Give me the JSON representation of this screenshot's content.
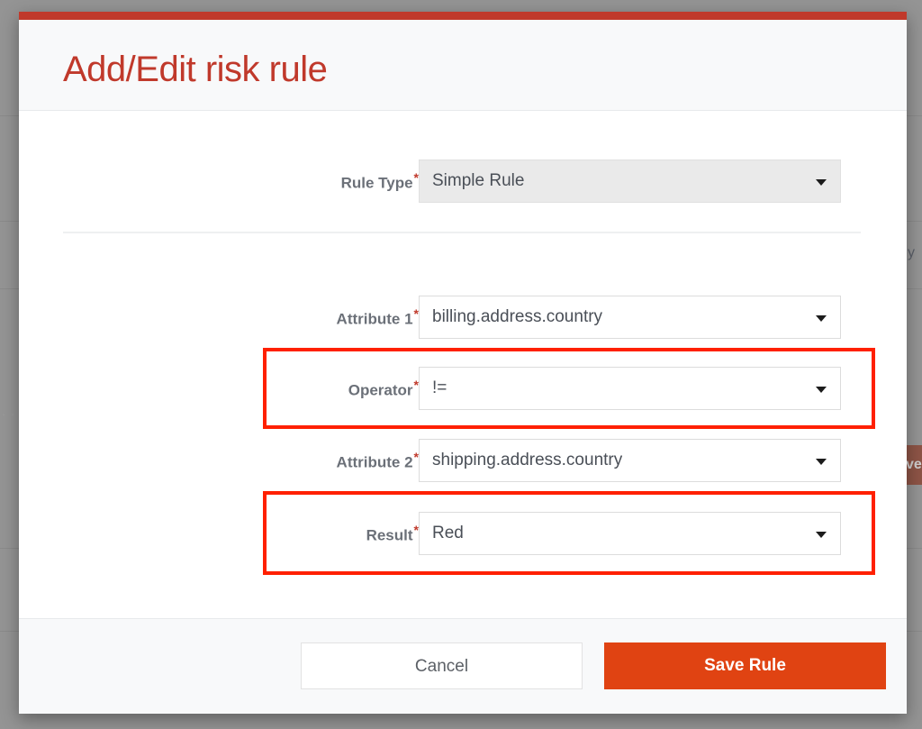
{
  "background": {
    "row_divider_ys": [
      128,
      245,
      320,
      608,
      700
    ],
    "ghost_text": "· · · · ·",
    "right_cell_text": "y",
    "right_button_label": "ve"
  },
  "modal": {
    "title": "Add/Edit risk rule",
    "accent_color": "#c0392b",
    "header_bg": "#f8f9fa",
    "fields": [
      {
        "label": "Rule Type",
        "required_marker": "*",
        "value": "Simple Rule",
        "muted": true,
        "highlighted": false,
        "caret_icon": "chevron-down-icon",
        "name": "rule-type"
      },
      {
        "label": "Attribute 1",
        "required_marker": "*",
        "value": "billing.address.country",
        "muted": false,
        "highlighted": false,
        "caret_icon": "chevron-down-icon",
        "name": "attribute-1"
      },
      {
        "label": "Operator",
        "required_marker": "*",
        "value": "!=",
        "muted": false,
        "highlighted": true,
        "caret_icon": "chevron-down-icon",
        "name": "operator"
      },
      {
        "label": "Attribute 2",
        "required_marker": "*",
        "value": "shipping.address.country",
        "muted": false,
        "highlighted": false,
        "caret_icon": "chevron-down-icon",
        "name": "attribute-2"
      },
      {
        "label": "Result",
        "required_marker": "*",
        "value": "Red",
        "muted": false,
        "highlighted": true,
        "caret_icon": "chevron-down-icon",
        "name": "result"
      }
    ],
    "annotation_color": "#ff2000",
    "footer": {
      "cancel_label": "Cancel",
      "save_label": "Save Rule",
      "save_color": "#e04312"
    }
  }
}
